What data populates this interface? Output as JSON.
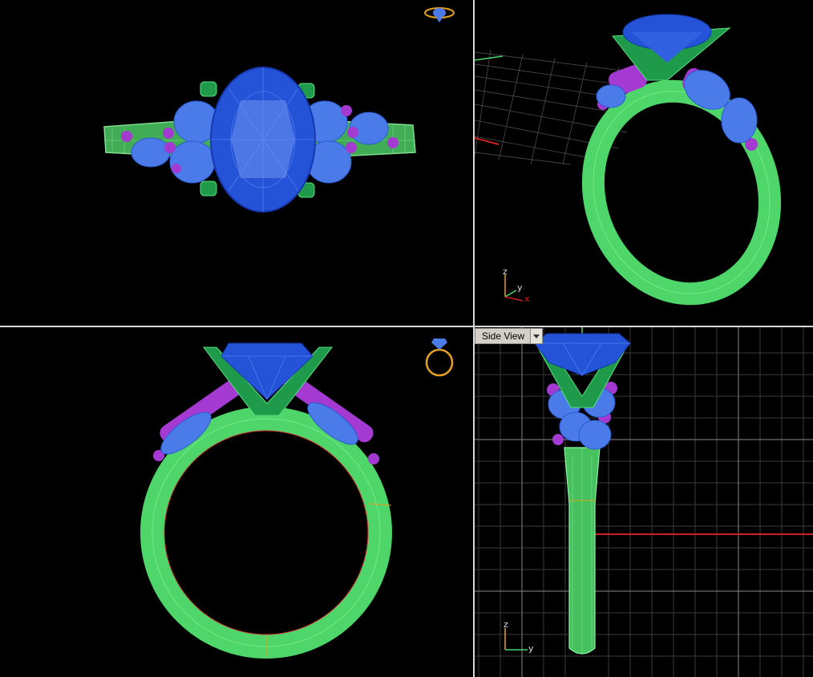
{
  "viewports": {
    "top": {
      "label": ""
    },
    "perspective": {
      "axis_labels": {
        "z": "z",
        "y": "y",
        "x": "x"
      }
    },
    "front": {
      "label": ""
    },
    "side": {
      "label": "Side View",
      "axis_labels": {
        "z": "z",
        "y": "y"
      }
    }
  },
  "colors": {
    "background": "#000000",
    "metal": "#4fd66a",
    "center_stone": "#1f4fd6",
    "side_stones": "#4a7be8",
    "accent_balls": "#a43ad1",
    "prongs": "#1f9a4a",
    "grid": "#3a3a3a",
    "x_axis": "#cc2222",
    "gold_icon": "#e6a020"
  },
  "icons": [
    "ring-top-view-icon",
    "ring-front-view-icon",
    "dropdown-arrow-icon"
  ]
}
